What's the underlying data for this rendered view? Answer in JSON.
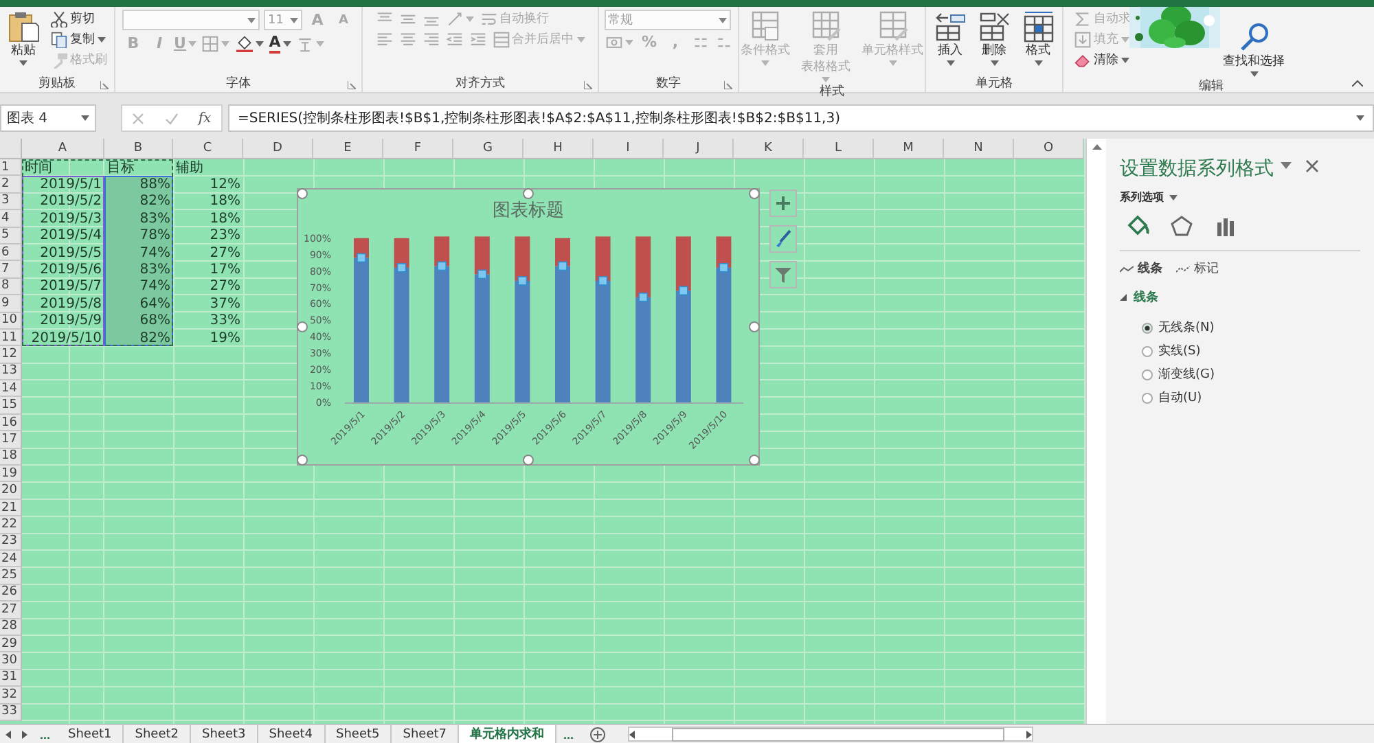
{
  "ribbon": {
    "groups": [
      {
        "label": "剪贴板",
        "launcher": true,
        "columns": [
          {
            "rows": [
              {
                "items": [
                  {
                    "kind": "paste",
                    "label": "粘贴",
                    "disabled": false,
                    "dropdown": true
                  }
                ]
              }
            ]
          },
          {
            "rows": [
              {
                "items": [
                  {
                    "kind": "cut",
                    "label": "剪切",
                    "disabled": false,
                    "dropdown": false
                  }
                ]
              },
              {
                "items": [
                  {
                    "kind": "copy",
                    "label": "复制",
                    "disabled": false,
                    "dropdown": true
                  }
                ]
              },
              {
                "items": [
                  {
                    "kind": "painter",
                    "label": "格式刷",
                    "disabled": true,
                    "dropdown": false
                  }
                ]
              }
            ]
          }
        ]
      },
      {
        "label": "字体",
        "launcher": true,
        "columns": [
          {
            "rows": [
              {
                "items": [
                  {
                    "kind": "fontname",
                    "disabled": true,
                    "dropdown": true
                  },
                  {
                    "kind": "fontsize",
                    "value": "11",
                    "disabled": true,
                    "dropdown": true
                  },
                  {
                    "kind": "grow",
                    "label": "A",
                    "disabled": true,
                    "dropdown": false
                  },
                  {
                    "kind": "shrink",
                    "label": "A",
                    "disabled": true,
                    "dropdown": false
                  }
                ]
              },
              {
                "items": [
                  {
                    "kind": "bold",
                    "label": "B",
                    "disabled": true,
                    "dropdown": false
                  },
                  {
                    "kind": "italic",
                    "label": "I",
                    "disabled": true,
                    "dropdown": false
                  },
                  {
                    "kind": "underline",
                    "label": "U",
                    "disabled": true,
                    "dropdown": true
                  },
                  {
                    "kind": "borders",
                    "disabled": true,
                    "dropdown": true
                  },
                  {
                    "kind": "fill",
                    "disabled": false,
                    "dropdown": true
                  },
                  {
                    "kind": "fontcolor",
                    "label": "A",
                    "disabled": false,
                    "dropdown": true
                  },
                  {
                    "kind": "phonetic",
                    "disabled": true,
                    "dropdown": true
                  }
                ]
              }
            ]
          }
        ]
      },
      {
        "label": "对齐方式",
        "launcher": true,
        "columns": [
          {
            "rows": [
              {
                "items": [
                  {
                    "kind": "aligntop",
                    "disabled": true,
                    "dropdown": false
                  },
                  {
                    "kind": "alignmiddle",
                    "disabled": true,
                    "dropdown": false
                  },
                  {
                    "kind": "alignbottom",
                    "disabled": true,
                    "dropdown": false
                  },
                  {
                    "kind": "orientation",
                    "disabled": true,
                    "dropdown": true
                  },
                  {
                    "kind": "wrap",
                    "label": "自动换行",
                    "disabled": true,
                    "dropdown": false
                  }
                ]
              },
              {
                "items": [
                  {
                    "kind": "alignleft",
                    "disabled": true,
                    "dropdown": false
                  },
                  {
                    "kind": "aligncenter",
                    "disabled": true,
                    "dropdown": false
                  },
                  {
                    "kind": "alignright",
                    "disabled": true,
                    "dropdown": false
                  },
                  {
                    "kind": "outdent",
                    "disabled": true,
                    "dropdown": false
                  },
                  {
                    "kind": "indent",
                    "disabled": true,
                    "dropdown": false
                  },
                  {
                    "kind": "merge",
                    "label": "合并后居中",
                    "disabled": true,
                    "dropdown": true
                  }
                ]
              }
            ]
          }
        ]
      },
      {
        "label": "数字",
        "launcher": true,
        "columns": [
          {
            "rows": [
              {
                "items": [
                  {
                    "kind": "numberformat",
                    "value": "常规",
                    "disabled": true,
                    "dropdown": true
                  }
                ]
              },
              {
                "items": [
                  {
                    "kind": "currency",
                    "disabled": true,
                    "dropdown": true
                  },
                  {
                    "kind": "percent",
                    "label": "%",
                    "disabled": true,
                    "dropdown": false
                  },
                  {
                    "kind": "comma",
                    "label": ",",
                    "disabled": true,
                    "dropdown": false
                  },
                  {
                    "kind": "incdecimal",
                    "disabled": true,
                    "dropdown": false
                  },
                  {
                    "kind": "decdecimal",
                    "disabled": true,
                    "dropdown": false
                  }
                ]
              }
            ]
          }
        ]
      },
      {
        "label": "样式",
        "launcher": false,
        "columns": [
          {
            "rows": [
              {
                "items": [
                  {
                    "kind": "conditional",
                    "label": [
                      "条件格式"
                    ],
                    "disabled": true,
                    "dropdown": true
                  }
                ]
              }
            ]
          },
          {
            "rows": [
              {
                "items": [
                  {
                    "kind": "tableformat",
                    "label": [
                      "套用",
                      "表格格式"
                    ],
                    "disabled": true,
                    "dropdown": true
                  }
                ]
              }
            ]
          },
          {
            "rows": [
              {
                "items": [
                  {
                    "kind": "cellstyle",
                    "label": [
                      "单元格样式"
                    ],
                    "disabled": true,
                    "dropdown": true
                  }
                ]
              }
            ]
          }
        ]
      },
      {
        "label": "单元格",
        "launcher": false,
        "columns": [
          {
            "rows": [
              {
                "items": [
                  {
                    "kind": "insert",
                    "label": "插入",
                    "disabled": false,
                    "dropdown": true
                  }
                ]
              }
            ]
          },
          {
            "rows": [
              {
                "items": [
                  {
                    "kind": "delete",
                    "label": "删除",
                    "disabled": false,
                    "dropdown": true
                  }
                ]
              }
            ]
          },
          {
            "rows": [
              {
                "items": [
                  {
                    "kind": "format",
                    "label": "格式",
                    "disabled": false,
                    "dropdown": true
                  }
                ]
              }
            ]
          }
        ]
      },
      {
        "label": "编辑",
        "launcher": false,
        "columns": [
          {
            "rows": [
              {
                "items": [
                  {
                    "kind": "sum",
                    "label": "自动求",
                    "disabled": true,
                    "dropdown": false
                  }
                ]
              },
              {
                "items": [
                  {
                    "kind": "filldown",
                    "label": "填充",
                    "disabled": true,
                    "dropdown": true
                  }
                ]
              },
              {
                "items": [
                  {
                    "kind": "eraser",
                    "label": "清除",
                    "disabled": false,
                    "dropdown": true
                  }
                ]
              }
            ]
          },
          {
            "rows": [
              {
                "items": [
                  {
                    "kind": "find",
                    "label": "查找和选择",
                    "disabled": false,
                    "dropdown": true
                  }
                ]
              }
            ]
          }
        ]
      }
    ]
  },
  "formula_bar": {
    "name_box": "图表 4",
    "function_label": "fx",
    "formula": "=SERIES(控制条柱形图表!$B$1,控制条柱形图表!$A$2:$A$11,控制条柱形图表!$B$2:$B$11,3)"
  },
  "sheet": {
    "columns": [
      "A",
      "B",
      "C",
      "D",
      "E",
      "F",
      "G",
      "H",
      "I",
      "J",
      "K",
      "L",
      "M",
      "N",
      "O"
    ],
    "rows": [
      {
        "number": "1",
        "cells": [
          "时间",
          "目标",
          "辅助"
        ]
      },
      {
        "number": "2",
        "cells": [
          "2019/5/1",
          "88%",
          "12%"
        ]
      },
      {
        "number": "3",
        "cells": [
          "2019/5/2",
          "82%",
          "18%"
        ]
      },
      {
        "number": "4",
        "cells": [
          "2019/5/3",
          "83%",
          "18%"
        ]
      },
      {
        "number": "5",
        "cells": [
          "2019/5/4",
          "78%",
          "23%"
        ]
      },
      {
        "number": "6",
        "cells": [
          "2019/5/5",
          "74%",
          "27%"
        ]
      },
      {
        "number": "7",
        "cells": [
          "2019/5/6",
          "83%",
          "17%"
        ]
      },
      {
        "number": "8",
        "cells": [
          "2019/5/7",
          "74%",
          "27%"
        ]
      },
      {
        "number": "9",
        "cells": [
          "2019/5/8",
          "64%",
          "37%"
        ]
      },
      {
        "number": "10",
        "cells": [
          "2019/5/9",
          "68%",
          "33%"
        ]
      },
      {
        "number": "11",
        "cells": [
          "2019/5/10",
          "82%",
          "19%"
        ]
      },
      {
        "number": "12"
      },
      {
        "number": "13"
      },
      {
        "number": "14"
      },
      {
        "number": "15"
      },
      {
        "number": "16"
      },
      {
        "number": "17"
      },
      {
        "number": "18"
      },
      {
        "number": "19"
      },
      {
        "number": "20"
      },
      {
        "number": "21"
      },
      {
        "number": "22"
      },
      {
        "number": "23"
      },
      {
        "number": "24"
      },
      {
        "number": "25"
      },
      {
        "number": "26"
      },
      {
        "number": "27"
      },
      {
        "number": "28"
      },
      {
        "number": "29"
      },
      {
        "number": "30"
      },
      {
        "number": "31"
      },
      {
        "number": "32"
      },
      {
        "number": "33"
      }
    ],
    "chart": {
      "chart_data": {
        "type": "bar",
        "title": "图表标题",
        "stacked": true,
        "orientation": "vertical",
        "categories": [
          "2019/5/1",
          "2019/5/2",
          "2019/5/3",
          "2019/5/4",
          "2019/5/5",
          "2019/5/6",
          "2019/5/7",
          "2019/5/8",
          "2019/5/9",
          "2019/5/10"
        ],
        "series": [
          {
            "color": "#4f81bd",
            "values": [
              0.88,
              0.82,
              0.83,
              0.78,
              0.74,
              0.83,
              0.74,
              0.64,
              0.68,
              0.82
            ]
          },
          {
            "color": "#c0504d",
            "values": [
              0.12,
              0.18,
              0.18,
              0.23,
              0.27,
              0.17,
              0.27,
              0.37,
              0.33,
              0.19
            ]
          }
        ],
        "ylim": [
          0,
          1.02
        ],
        "yticks": [
          {
            "value": 0,
            "label": "0%"
          },
          {
            "value": 0.1,
            "label": "10%"
          },
          {
            "value": 0.2,
            "label": "20%"
          },
          {
            "value": 0.3,
            "label": "30%"
          },
          {
            "value": 0.4,
            "label": "40%"
          },
          {
            "value": 0.5,
            "label": "50%"
          },
          {
            "value": 0.6,
            "label": "60%"
          },
          {
            "value": 0.7,
            "label": "70%"
          },
          {
            "value": 0.8,
            "label": "80%"
          },
          {
            "value": 0.9,
            "label": "90%"
          },
          {
            "value": 1,
            "label": "100%"
          }
        ]
      },
      "series_states": [
        {
          "selected": true
        },
        {
          "selected": false
        }
      ],
      "side_buttons": [
        {
          "kind": "plus"
        },
        {
          "kind": "brush"
        },
        {
          "kind": "filter"
        }
      ]
    }
  },
  "pane": {
    "title": "设置数据系列格式",
    "options_label": "系列选项",
    "icon_tabs": [
      {
        "kind": "fill",
        "selected": true
      },
      {
        "kind": "effects",
        "selected": false
      },
      {
        "kind": "series",
        "selected": false
      }
    ],
    "tabs": [
      {
        "label": "线条",
        "selected": true
      },
      {
        "label": "标记",
        "selected": false
      }
    ],
    "section": {
      "label": "线条",
      "expanded": true
    },
    "options": [
      {
        "label": "无线条(N)",
        "selected": true
      },
      {
        "label": "实线(S)",
        "selected": false
      },
      {
        "label": "渐变线(G)",
        "selected": false
      },
      {
        "label": "自动(U)",
        "selected": false
      }
    ]
  },
  "sheet_tabs": {
    "more_left": "...",
    "tabs": [
      {
        "label": "Sheet1",
        "selected": false
      },
      {
        "label": "Sheet2",
        "selected": false
      },
      {
        "label": "Sheet3",
        "selected": false
      },
      {
        "label": "Sheet4",
        "selected": false
      },
      {
        "label": "Sheet5",
        "selected": false
      },
      {
        "label": "Sheet7",
        "selected": false
      },
      {
        "label": "单元格内求和",
        "selected": true
      }
    ],
    "more_right": "..."
  }
}
